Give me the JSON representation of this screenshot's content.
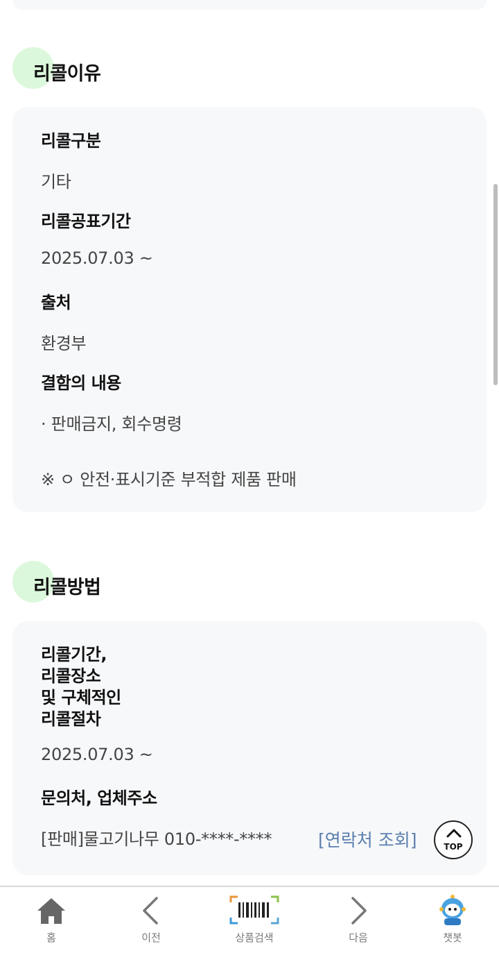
{
  "recall_reason": {
    "section_title": "리콜이유",
    "type_label": "리콜구분",
    "type_value": "기타",
    "period_label": "리콜공표기간",
    "period_value": "2025.07.03 ~",
    "source_label": "출처",
    "source_value": "환경부",
    "defect_label": "결함의 내용",
    "defect_value": "· 판매금지, 회수명령",
    "defect_note": "※ ㅇ 안전·표시기준 부적합 제품 판매"
  },
  "recall_method": {
    "section_title": "리콜방법",
    "procedure_label_lines": [
      "리콜기간,",
      "리콜장소",
      "및 구체적인",
      "리콜절차"
    ],
    "procedure_value": "2025.07.03 ~",
    "contact_label": "문의처, 업체주소",
    "contact_value": "[판매]물고기나무 010-****-****",
    "contact_link": "[연락처 조회]"
  },
  "top_button": {
    "label": "TOP"
  },
  "bottom_nav": {
    "items": [
      {
        "label": "홈",
        "icon": "home-icon"
      },
      {
        "label": "이전",
        "icon": "chevron-left-icon"
      },
      {
        "label": "상품검색",
        "icon": "barcode-scan-icon"
      },
      {
        "label": "다음",
        "icon": "chevron-right-icon"
      },
      {
        "label": "챗봇",
        "icon": "chatbot-avatar-icon"
      }
    ]
  },
  "colors": {
    "accent_green_dot": "#dcf8dc",
    "card_bg": "#f7f8fa",
    "link_blue": "#5b7fae",
    "nav_label": "#7a7a7a"
  }
}
